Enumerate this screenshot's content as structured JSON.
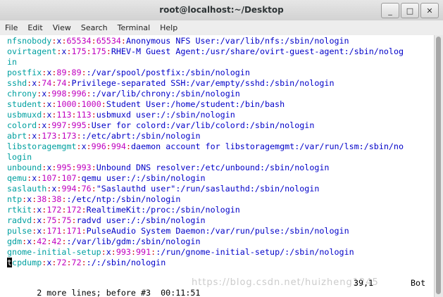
{
  "window": {
    "title": "root@localhost:~/Desktop",
    "controls": [
      "_",
      "□",
      "✕"
    ]
  },
  "menubar": [
    "File",
    "Edit",
    "View",
    "Search",
    "Terminal",
    "Help"
  ],
  "terminal": {
    "lines": [
      {
        "user": "nfsnobody",
        "p1": "x",
        "ids": "65534:65534",
        "rest": "Anonymous NFS User:/var/lib/nfs:/sbin/nologin"
      },
      {
        "user": "ovirtagent",
        "p1": "x",
        "ids": "175:175",
        "rest": "RHEV-M Guest Agent:/usr/share/ovirt-guest-agent:/sbin/nolog"
      },
      {
        "user": "in",
        "p1": "",
        "ids": "",
        "rest": ""
      },
      {
        "user": "postfix",
        "p1": "x",
        "ids": "89:89",
        "rest": ":/var/spool/postfix:/sbin/nologin"
      },
      {
        "user": "sshd",
        "p1": "x",
        "ids": "74:74",
        "rest": "Privilege-separated SSH:/var/empty/sshd:/sbin/nologin"
      },
      {
        "user": "chrony",
        "p1": "x",
        "ids": "998:996",
        "rest": ":/var/lib/chrony:/sbin/nologin"
      },
      {
        "user": "student",
        "p1": "x",
        "ids": "1000:1000",
        "rest": "Student User:/home/student:/bin/bash"
      },
      {
        "user": "usbmuxd",
        "p1": "x",
        "ids": "113:113",
        "rest": "usbmuxd user:/:/sbin/nologin"
      },
      {
        "user": "colord",
        "p1": "x",
        "ids": "997:995",
        "rest": "User for colord:/var/lib/colord:/sbin/nologin"
      },
      {
        "user": "abrt",
        "p1": "x",
        "ids": "173:173",
        "rest": ":/etc/abrt:/sbin/nologin"
      },
      {
        "user": "libstoragemgmt",
        "p1": "x",
        "ids": "996:994",
        "rest": "daemon account for libstoragemgmt:/var/run/lsm:/sbin/no"
      },
      {
        "user": "login",
        "p1": "",
        "ids": "",
        "rest": ""
      },
      {
        "user": "unbound",
        "p1": "x",
        "ids": "995:993",
        "rest": "Unbound DNS resolver:/etc/unbound:/sbin/nologin"
      },
      {
        "user": "qemu",
        "p1": "x",
        "ids": "107:107",
        "rest": "qemu user:/:/sbin/nologin"
      },
      {
        "user": "saslauth",
        "p1": "x",
        "ids": "994:76",
        "rest": "\"Saslauthd user\":/run/saslauthd:/sbin/nologin"
      },
      {
        "user": "ntp",
        "p1": "x",
        "ids": "38:38",
        "rest": ":/etc/ntp:/sbin/nologin"
      },
      {
        "user": "rtkit",
        "p1": "x",
        "ids": "172:172",
        "rest": "RealtimeKit:/proc:/sbin/nologin"
      },
      {
        "user": "radvd",
        "p1": "x",
        "ids": "75:75",
        "rest": "radvd user:/:/sbin/nologin"
      },
      {
        "user": "pulse",
        "p1": "x",
        "ids": "171:171",
        "rest": "PulseAudio System Daemon:/var/run/pulse:/sbin/nologin"
      },
      {
        "user": "gdm",
        "p1": "x",
        "ids": "42:42",
        "rest": ":/var/lib/gdm:/sbin/nologin"
      },
      {
        "user": "gnome-initial-setup",
        "p1": "x",
        "ids": "993:991",
        "rest": ":/run/gnome-initial-setup/:/sbin/nologin"
      },
      {
        "user": "tcpdump",
        "p1": "x",
        "ids": "72:72",
        "rest": ":/:/sbin/nologin",
        "cursor": true
      }
    ],
    "status": {
      "message": "2 more lines; before #3  00:11:51",
      "position": "39,1",
      "percent": "Bot"
    },
    "watermark": "https://blog.csdn.net/huizheng1245"
  },
  "colors": {
    "username": "#00a0a0",
    "separator": "#d01010",
    "ids": "#c000c0",
    "text": "#0000c8"
  }
}
